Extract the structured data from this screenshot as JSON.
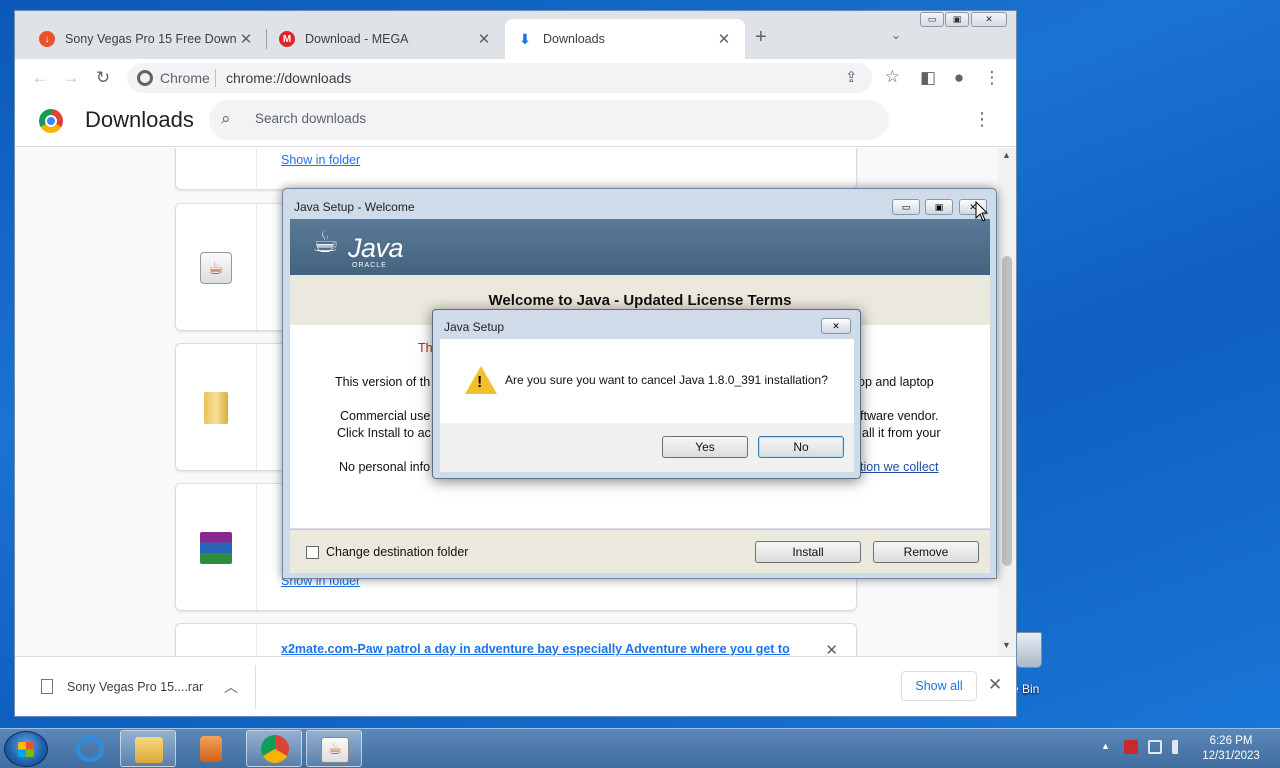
{
  "browser": {
    "tabs": [
      {
        "title": "Sony Vegas Pro 15 Free Downloa",
        "close": "✕"
      },
      {
        "title": "Download - MEGA",
        "close": "✕"
      },
      {
        "title": "Downloads",
        "close": "✕"
      }
    ],
    "new_tab": "+",
    "omnibox": {
      "site_label": "Chrome",
      "url": "chrome://downloads"
    },
    "window_controls": {
      "minimize": "▭",
      "restore": "▣",
      "close": "✕"
    }
  },
  "downloads_page": {
    "title": "Downloads",
    "search_placeholder": "Search downloads",
    "items": [
      {
        "link": "Show in folder"
      },
      {
        "link": "Show in folder"
      },
      {
        "link": "x2mate.com-Paw patrol a day in adventure bay especially Adventure where you get to",
        "close": "✕"
      }
    ]
  },
  "download_shelf": {
    "filename": "Sony Vegas Pro 15....rar",
    "show_all": "Show all",
    "close": "✕"
  },
  "java_setup": {
    "title": "Java Setup - Welcome",
    "brand": "Java",
    "brand_sub": "ORACLE",
    "heading": "Welcome to Java - Updated License Terms",
    "line_red": "Th",
    "line1_left": "This version of th",
    "line1_right": "op and laptop",
    "line2_left": "Commercial use",
    "line2_right": "ftware vendor.",
    "line3_left": "Click Install to ac",
    "line3_right": "all it from your",
    "line4_left": "No personal info",
    "line4_link": "tion we collect",
    "dest_checkbox": "Change destination folder",
    "install": "Install",
    "remove": "Remove"
  },
  "confirm_dialog": {
    "title": "Java Setup",
    "message": "Are you sure you want to cancel Java 1.8.0_391 installation?",
    "yes": "Yes",
    "no": "No",
    "close": "✕"
  },
  "desktop": {
    "recycle_label": "e Bin"
  },
  "taskbar": {
    "time": "6:26 PM",
    "date": "12/31/2023"
  },
  "colors": {
    "chrome_blue": "#1a73e8",
    "java_banner": "#4d6c8a",
    "warning": "#f2c028",
    "desktop": "#1565c0"
  }
}
